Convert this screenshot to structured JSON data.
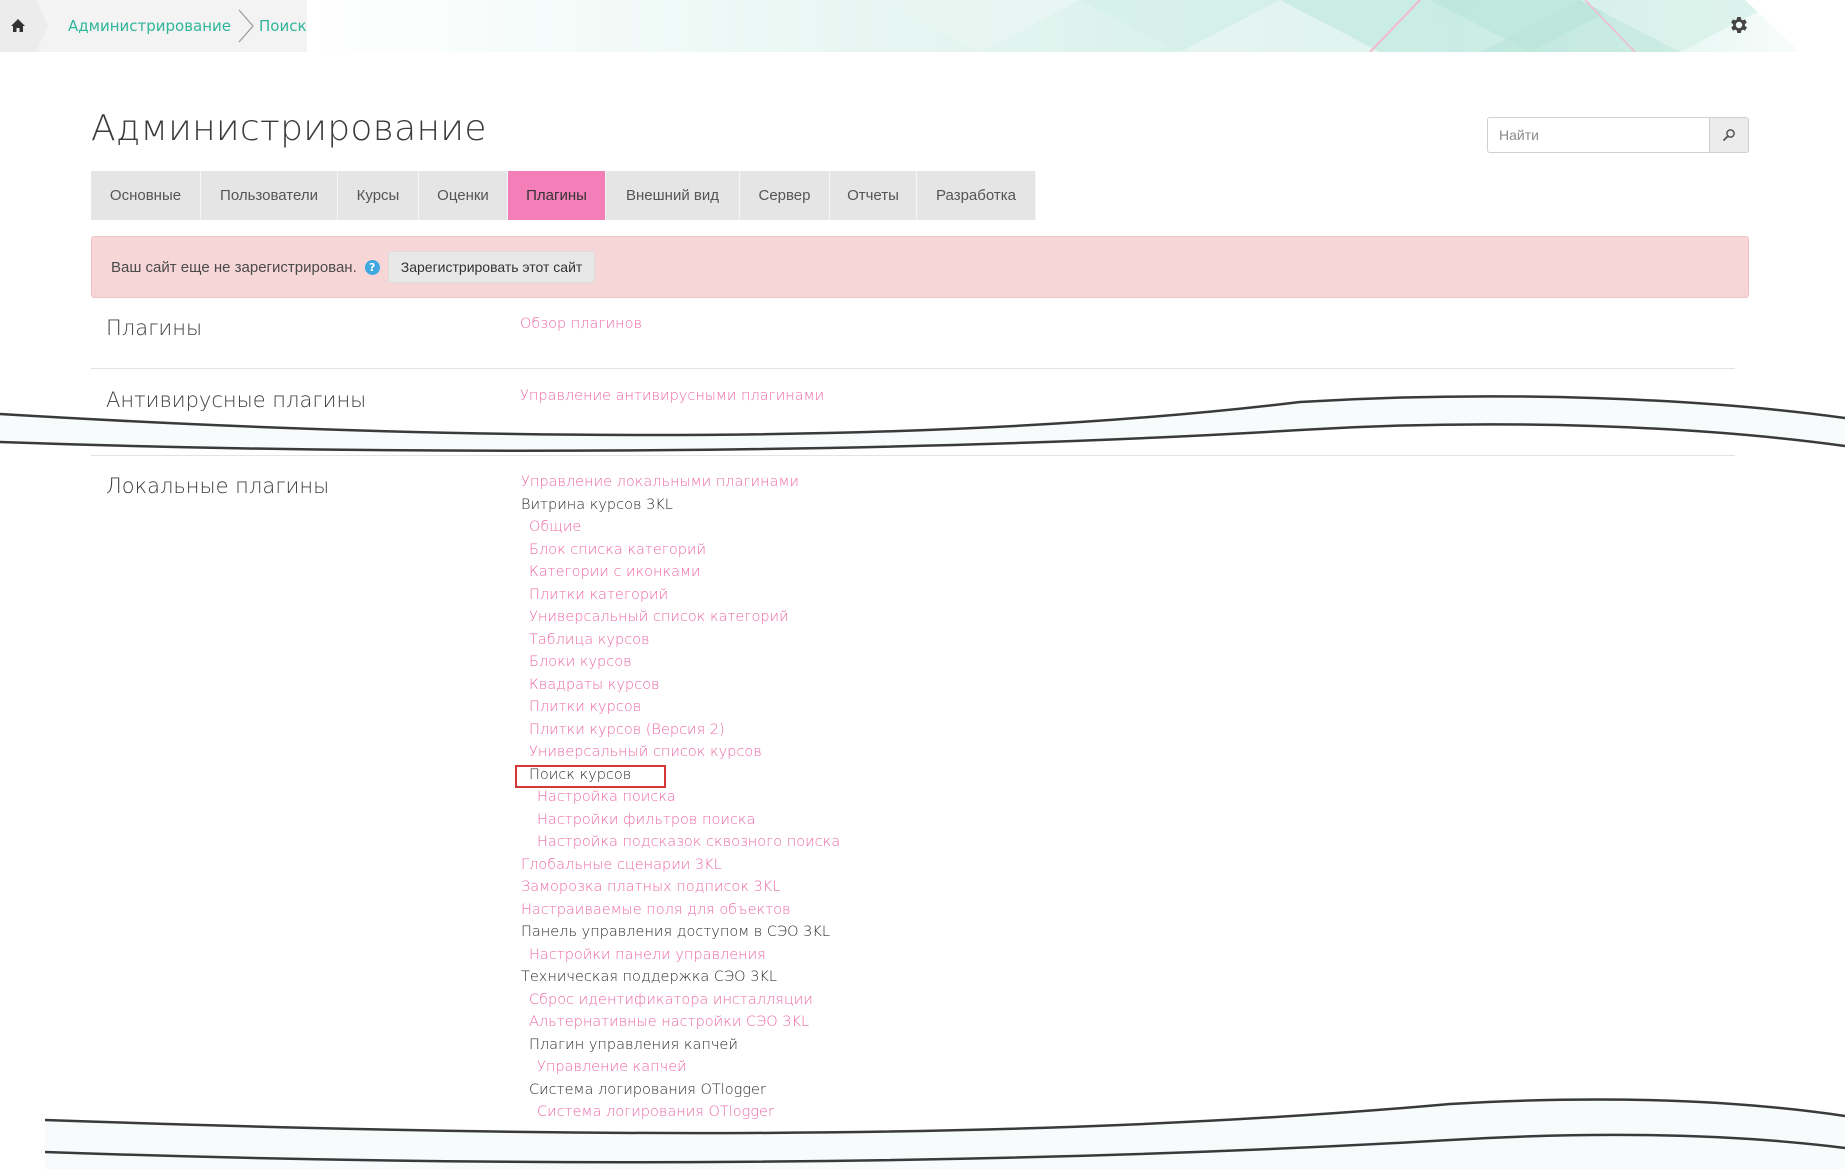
{
  "breadcrumb": {
    "items": [
      "Администрирование",
      "Поиск"
    ]
  },
  "header": {
    "title": "Администрирование",
    "search_placeholder": "Найти"
  },
  "tabs": [
    {
      "label": "Основные",
      "active": false
    },
    {
      "label": "Пользователи",
      "active": false
    },
    {
      "label": "Курсы",
      "active": false
    },
    {
      "label": "Оценки",
      "active": false
    },
    {
      "label": "Плагины",
      "active": true
    },
    {
      "label": "Внешний вид",
      "active": false
    },
    {
      "label": "Сервер",
      "active": false
    },
    {
      "label": "Отчеты",
      "active": false
    },
    {
      "label": "Разработка",
      "active": false
    }
  ],
  "alert": {
    "text": "Ваш сайт еще не зарегистрирован.",
    "help_icon": "question-circle-icon",
    "button_label": "Зарегистрировать этот сайт"
  },
  "sections": {
    "plugins": {
      "title": "Плагины",
      "links": [
        "Обзор плагинов"
      ]
    },
    "antivirus": {
      "title": "Антивирусные плагины",
      "links": [
        "Управление антивирусными плагинами"
      ]
    },
    "local": {
      "title": "Локальные плагины",
      "entries": [
        {
          "text": "Управление локальными плагинами",
          "kind": "link",
          "level": 0
        },
        {
          "text": "Витрина курсов 3KL",
          "kind": "plain",
          "level": 0
        },
        {
          "text": "Общие",
          "kind": "link",
          "level": 1
        },
        {
          "text": "Блок списка категорий",
          "kind": "link",
          "level": 1
        },
        {
          "text": "Категории с иконками",
          "kind": "link",
          "level": 1
        },
        {
          "text": "Плитки категорий",
          "kind": "link",
          "level": 1
        },
        {
          "text": "Универсальный список категорий",
          "kind": "link",
          "level": 1
        },
        {
          "text": "Таблица курсов",
          "kind": "link",
          "level": 1
        },
        {
          "text": "Блоки курсов",
          "kind": "link",
          "level": 1
        },
        {
          "text": "Квадраты курсов",
          "kind": "link",
          "level": 1
        },
        {
          "text": "Плитки курсов",
          "kind": "link",
          "level": 1
        },
        {
          "text": "Плитки курсов (Версия 2)",
          "kind": "link",
          "level": 1
        },
        {
          "text": "Универсальный список курсов",
          "kind": "link",
          "level": 1
        },
        {
          "text": "Поиск курсов",
          "kind": "plain",
          "level": 1,
          "highlighted": true
        },
        {
          "text": "Настройка поиска",
          "kind": "link",
          "level": 2
        },
        {
          "text": "Настройки фильтров поиска",
          "kind": "link",
          "level": 2
        },
        {
          "text": "Настройка подсказок сквозного поиска",
          "kind": "link",
          "level": 2
        },
        {
          "text": "Глобальные сценарии 3KL",
          "kind": "link",
          "level": 0
        },
        {
          "text": "Заморозка платных подписок 3KL",
          "kind": "link",
          "level": 0
        },
        {
          "text": "Настраиваемые поля для объектов",
          "kind": "link",
          "level": 0
        },
        {
          "text": "Панель управления доступом в СЭО 3KL",
          "kind": "plain",
          "level": 0
        },
        {
          "text": "Настройки панели управления",
          "kind": "link",
          "level": 1
        },
        {
          "text": "Техническая поддержка СЭО 3KL",
          "kind": "plain",
          "level": 0
        },
        {
          "text": "Сброс идентификатора инсталляции",
          "kind": "link",
          "level": 1
        },
        {
          "text": "Альтернативные настройки СЭО 3KL",
          "kind": "link",
          "level": 1
        },
        {
          "text": "Плагин управления капчей",
          "kind": "plain",
          "level": 1
        },
        {
          "text": "Управление капчей",
          "kind": "link",
          "level": 2
        },
        {
          "text": "Система логирования OTlogger",
          "kind": "plain",
          "level": 1
        },
        {
          "text": "Система логирования OTlogger",
          "kind": "link",
          "level": 2
        }
      ]
    }
  },
  "colors": {
    "accent_link": "#ec6aa6",
    "active_tab": "#f47fb8",
    "breadcrumb_link": "#2fb59a",
    "alert_bg": "#f7d6d8",
    "highlight": "#d23a3a"
  },
  "icons": {
    "home": "home-icon",
    "settings": "gear-icon",
    "search": "search-icon"
  }
}
